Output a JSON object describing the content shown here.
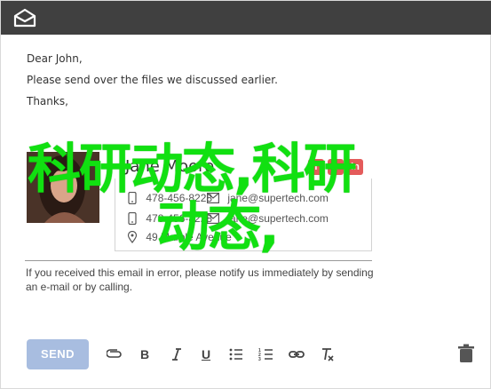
{
  "email": {
    "greeting": "Dear John,",
    "body_line": "Please send over the files we discussed earlier.",
    "signoff": "Thanks,"
  },
  "signature": {
    "name": "Jane Moore",
    "phone1": "478-456-8228",
    "email1": "jane@supertech.com",
    "phone2": "478-456-8228",
    "email2": "jane@supertech.com",
    "address": "49 Marble Avenue",
    "social": [
      "f",
      "t",
      "in"
    ]
  },
  "disclaimer": "If you received this email in error, please notify us immediately by sending an e-mail or by calling.",
  "overlay": {
    "line1": "科研动态,科研",
    "line2": "动态,"
  },
  "toolbar": {
    "send_label": "SEND",
    "bold_label": "B",
    "underline_label": "U"
  },
  "colors": {
    "titlebar": "#404040",
    "send_button": "#a8bde0",
    "overlay_text": "#11e011"
  }
}
